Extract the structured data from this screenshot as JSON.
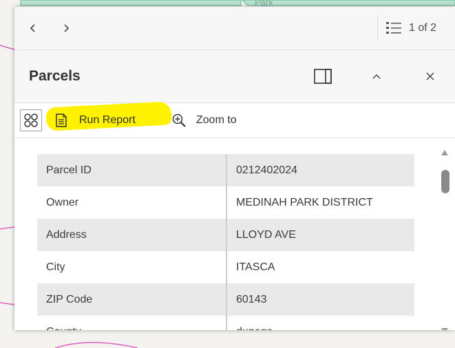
{
  "map": {
    "label": "Park"
  },
  "navigation": {
    "feature_count": "1 of 2"
  },
  "header": {
    "title": "Parcels"
  },
  "actions": {
    "run_report_label": "Run Report",
    "zoom_to_label": "Zoom to",
    "highlight_color": "#fff200"
  },
  "attributes": {
    "rows": [
      {
        "field": "Parcel ID",
        "value": "0212402024"
      },
      {
        "field": "Owner",
        "value": "MEDINAH PARK DISTRICT"
      },
      {
        "field": "Address",
        "value": "LLOYD AVE"
      },
      {
        "field": "City",
        "value": "ITASCA"
      },
      {
        "field": "ZIP Code",
        "value": "60143"
      },
      {
        "field": "County",
        "value": "dupage"
      }
    ]
  }
}
